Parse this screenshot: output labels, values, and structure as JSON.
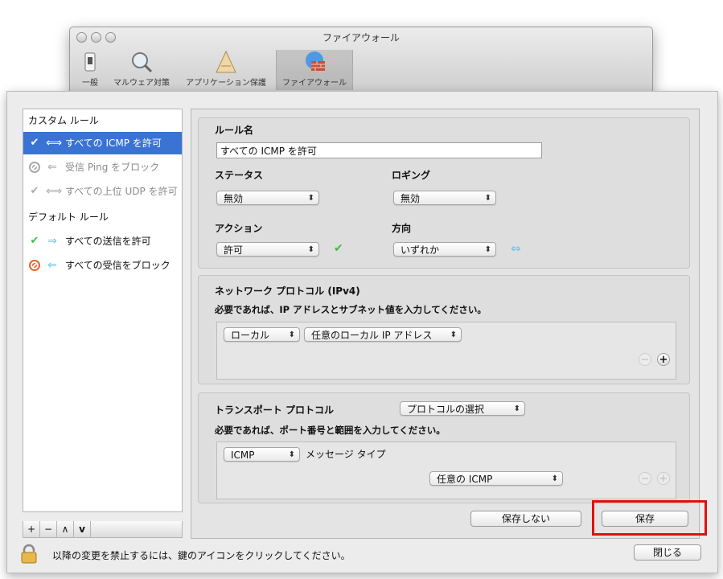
{
  "window": {
    "title": "ファイアウォール",
    "toolbar": [
      {
        "label": "一般",
        "icon": "switch-icon"
      },
      {
        "label": "マルウェア対策",
        "icon": "magnifier-icon"
      },
      {
        "label": "アプリケーション保護",
        "icon": "app-protection-icon"
      },
      {
        "label": "ファイアウォール",
        "icon": "firewall-icon"
      }
    ]
  },
  "rules": {
    "custom_header": "カスタム ルール",
    "default_header": "デフォルト ルール",
    "custom": [
      {
        "label": "すべての ICMP を許可",
        "selected": true
      },
      {
        "label": "受信 Ping をブロック",
        "selected": false
      },
      {
        "label": "すべての上位 UDP を許可",
        "selected": false
      }
    ],
    "default": [
      {
        "label": "すべての送信を許可"
      },
      {
        "label": "すべての受信をブロック"
      }
    ],
    "toolbar": {
      "add": "+",
      "remove": "−",
      "up": "∧",
      "down": "v"
    }
  },
  "form": {
    "rule_name_label": "ルール名",
    "rule_name_value": "すべての ICMP を許可",
    "status_label": "ステータス",
    "status_value": "無効",
    "logging_label": "ロギング",
    "logging_value": "無効",
    "action_label": "アクション",
    "action_value": "許可",
    "direction_label": "方向",
    "direction_value": "いずれか"
  },
  "network": {
    "title": "ネットワーク プロトコル (IPv4)",
    "hint": "必要であれば、IP アドレスとサブネット値を入力してください。",
    "scope_value": "ローカル",
    "address_value": "任意のローカル IP アドレス",
    "remove": "−",
    "add": "+"
  },
  "transport": {
    "title": "トランスポート プロトコル",
    "protocol_select": "プロトコルの選択",
    "hint": "必要であれば、ポート番号と範囲を入力してください。",
    "protocol_value": "ICMP",
    "message_type_label": "メッセージ タイプ",
    "message_type_value": "任意の ICMP",
    "remove": "−",
    "add": "+"
  },
  "buttons": {
    "dont_save": "保存しない",
    "save": "保存",
    "close": "閉じる"
  },
  "lock_text": "以降の変更を禁止するには、鍵のアイコンをクリックしてください。",
  "colors": {
    "selection": "#3b73d4",
    "highlight": "#e01010",
    "allow": "#3bbf3b",
    "block": "#e8642a",
    "direction": "#6fc0e8"
  }
}
